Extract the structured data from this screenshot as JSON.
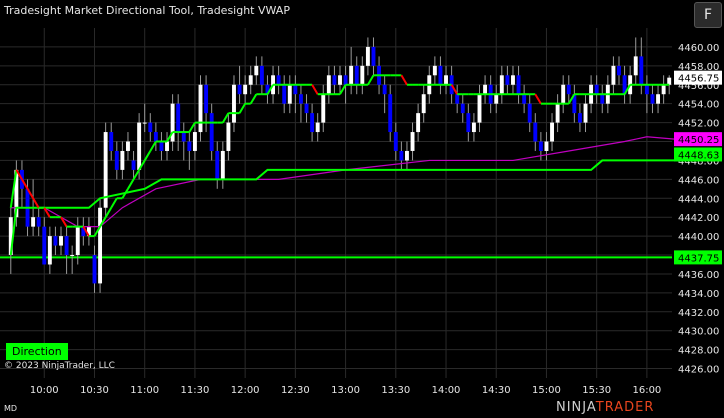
{
  "header": {
    "title": "Tradesight Market Directional Tool, Tradesight VWAP",
    "f_button": "F"
  },
  "overlay": {
    "direction_label": "Direction",
    "copyright": "© 2023 NinjaTrader, LLC",
    "md_label": "MD"
  },
  "brand": {
    "part1": "NINJA",
    "part2": "TRADER",
    "part2_color": "#e8451e"
  },
  "colors": {
    "background": "#000000",
    "grid": "#2a2a2a",
    "up_candle": "#ffffff",
    "down_candle": "#0000ff",
    "vwap_up": "#00ff00",
    "vwap_down": "#ff0000",
    "directional": "#00ff00",
    "magenta_line": "#c000c0",
    "current_price_box": "#ffffff",
    "magenta_box": "#ff00ff",
    "green_box": "#00ff00"
  },
  "chart_data": {
    "type": "candlestick",
    "title": "Tradesight Market Directional Tool, Tradesight VWAP",
    "ylim": [
      4425,
      4462
    ],
    "y_ticks": [
      "4460.00",
      "4458.00",
      "4456.00",
      "4454.00",
      "4452.00",
      "4450.00",
      "4448.00",
      "4446.00",
      "4444.00",
      "4442.00",
      "4440.00",
      "4438.00",
      "4436.00",
      "4434.00",
      "4432.00",
      "4430.00",
      "4428.00",
      "4426.00"
    ],
    "x_ticks": [
      "10:00",
      "10:30",
      "11:00",
      "11:30",
      "12:00",
      "12:30",
      "13:00",
      "13:30",
      "14:00",
      "14:30",
      "15:00",
      "15:30",
      "16:00"
    ],
    "x_tick_index": [
      6,
      15,
      24,
      33,
      42,
      51,
      60,
      69,
      78,
      87,
      96,
      105,
      114
    ],
    "candles": [
      [
        4438,
        4442,
        4436,
        4443
      ],
      [
        4442,
        4447,
        4441,
        4448
      ],
      [
        4447,
        4445,
        4443,
        4448
      ],
      [
        4445,
        4441,
        4440,
        4446
      ],
      [
        4441,
        4442,
        4440,
        4446
      ],
      [
        4442,
        4441,
        4440,
        4443
      ],
      [
        4441,
        4437,
        4437,
        4442
      ],
      [
        4437,
        4440,
        4436,
        4441
      ],
      [
        4440,
        4439,
        4438,
        4441
      ],
      [
        4439,
        4440,
        4438,
        4441
      ],
      [
        4440,
        4438,
        4436,
        4441
      ],
      [
        4438,
        4438,
        4436,
        4439
      ],
      [
        4438,
        4441,
        4437,
        4442
      ],
      [
        4441,
        4440,
        4439,
        4442
      ],
      [
        4440,
        4441,
        4439,
        4442
      ],
      [
        4438,
        4435,
        4434,
        4439
      ],
      [
        4435,
        4443,
        4434,
        4444
      ],
      [
        4443,
        4451,
        4442,
        4452
      ],
      [
        4451,
        4449,
        4448,
        4452
      ],
      [
        4449,
        4447,
        4446,
        4450
      ],
      [
        4447,
        4449,
        4446,
        4450
      ],
      [
        4449,
        4450,
        4448,
        4451
      ],
      [
        4448,
        4447,
        4446,
        4449
      ],
      [
        4447,
        4452,
        4446,
        4453
      ],
      [
        4452,
        4452,
        4451,
        4454
      ],
      [
        4452,
        4451,
        4450,
        4453
      ],
      [
        4451,
        4450,
        4449,
        4452
      ],
      [
        4450,
        4449,
        4448,
        4451
      ],
      [
        4449,
        4450,
        4448,
        4451
      ],
      [
        4450,
        4454,
        4449,
        4455
      ],
      [
        4454,
        4451,
        4449,
        4455
      ],
      [
        4451,
        4450,
        4448,
        4452
      ],
      [
        4450,
        4449,
        4447,
        4451
      ],
      [
        4449,
        4451,
        4448,
        4452
      ],
      [
        4451,
        4456,
        4450,
        4457
      ],
      [
        4456,
        4453,
        4451,
        4457
      ],
      [
        4453,
        4449,
        4448,
        4454
      ],
      [
        4449,
        4446,
        4445,
        4450
      ],
      [
        4446,
        4449,
        4445,
        4450
      ],
      [
        4449,
        4452,
        4448,
        4453
      ],
      [
        4452,
        4456,
        4451,
        4457
      ],
      [
        4456,
        4455,
        4454,
        4458
      ],
      [
        4455,
        4456,
        4454,
        4457
      ],
      [
        4456,
        4457,
        4455,
        4458
      ],
      [
        4457,
        4458,
        4456,
        4459
      ],
      [
        4458,
        4456,
        4455,
        4459
      ],
      [
        4456,
        4455,
        4454,
        4457
      ],
      [
        4455,
        4457,
        4454,
        4458
      ],
      [
        4457,
        4456,
        4455,
        4458
      ],
      [
        4456,
        4454,
        4453,
        4457
      ],
      [
        4454,
        4456,
        4453,
        4457
      ],
      [
        4456,
        4455,
        4453,
        4457
      ],
      [
        4455,
        4454,
        4452,
        4456
      ],
      [
        4454,
        4453,
        4452,
        4455
      ],
      [
        4453,
        4451,
        4450,
        4454
      ],
      [
        4451,
        4452,
        4450,
        4453
      ],
      [
        4452,
        4455,
        4451,
        4456
      ],
      [
        4455,
        4457,
        4454,
        4458
      ],
      [
        4457,
        4456,
        4455,
        4458
      ],
      [
        4456,
        4457,
        4455,
        4458
      ],
      [
        4457,
        4456,
        4454,
        4458
      ],
      [
        4456,
        4458,
        4455,
        4460
      ],
      [
        4458,
        4456,
        4455,
        4459
      ],
      [
        4456,
        4458,
        4455,
        4459
      ],
      [
        4458,
        4460,
        4457,
        4461
      ],
      [
        4460,
        4458,
        4457,
        4461
      ],
      [
        4458,
        4456,
        4455,
        4459
      ],
      [
        4456,
        4455,
        4453,
        4457
      ],
      [
        4455,
        4451,
        4450,
        4456
      ],
      [
        4451,
        4449,
        4448,
        4452
      ],
      [
        4449,
        4448,
        4447,
        4450
      ],
      [
        4448,
        4449,
        4447,
        4450
      ],
      [
        4449,
        4451,
        4448,
        4452
      ],
      [
        4451,
        4453,
        4450,
        4454
      ],
      [
        4453,
        4455,
        4452,
        4456
      ],
      [
        4455,
        4457,
        4454,
        4458
      ],
      [
        4457,
        4458,
        4456,
        4459
      ],
      [
        4458,
        4456,
        4455,
        4459
      ],
      [
        4456,
        4457,
        4455,
        4458
      ],
      [
        4457,
        4455,
        4454,
        4458
      ],
      [
        4455,
        4454,
        4453,
        4456
      ],
      [
        4454,
        4453,
        4452,
        4455
      ],
      [
        4453,
        4451,
        4450,
        4454
      ],
      [
        4451,
        4452,
        4450,
        4453
      ],
      [
        4452,
        4455,
        4451,
        4456
      ],
      [
        4455,
        4456,
        4454,
        4457
      ],
      [
        4456,
        4454,
        4453,
        4457
      ],
      [
        4454,
        4455,
        4453,
        4456
      ],
      [
        4455,
        4457,
        4454,
        4458
      ],
      [
        4457,
        4456,
        4455,
        4458
      ],
      [
        4456,
        4457,
        4455,
        4458
      ],
      [
        4457,
        4455,
        4454,
        4458
      ],
      [
        4455,
        4454,
        4453,
        4456
      ],
      [
        4454,
        4452,
        4451,
        4455
      ],
      [
        4452,
        4450,
        4449,
        4453
      ],
      [
        4450,
        4449,
        4448,
        4451
      ],
      [
        4449,
        4450,
        4448,
        4451
      ],
      [
        4450,
        4452,
        4449,
        4453
      ],
      [
        4452,
        4454,
        4451,
        4455
      ],
      [
        4454,
        4456,
        4453,
        4457
      ],
      [
        4456,
        4455,
        4454,
        4457
      ],
      [
        4455,
        4453,
        4452,
        4456
      ],
      [
        4453,
        4452,
        4451,
        4454
      ],
      [
        4452,
        4454,
        4451,
        4455
      ],
      [
        4454,
        4456,
        4453,
        4457
      ],
      [
        4456,
        4455,
        4454,
        4457
      ],
      [
        4455,
        4454,
        4453,
        4456
      ],
      [
        4454,
        4456,
        4453,
        4457
      ],
      [
        4456,
        4458,
        4455,
        4459
      ],
      [
        4458,
        4457,
        4456,
        4459
      ],
      [
        4457,
        4455,
        4454,
        4458
      ],
      [
        4455,
        4457,
        4454,
        4458
      ],
      [
        4457,
        4459,
        4456,
        4461
      ],
      [
        4459,
        4456,
        4455,
        4461
      ],
      [
        4456,
        4455,
        4453,
        4457
      ],
      [
        4455,
        4454,
        4453,
        4456
      ],
      [
        4454,
        4455,
        4453,
        4456
      ],
      [
        4455,
        4456,
        4454,
        4457
      ],
      [
        4456,
        4456.75,
        4455,
        4457
      ]
    ],
    "vwap": [
      4443,
      4447,
      4446,
      4445,
      4444,
      4443,
      4443,
      4442,
      4442,
      4442,
      4441,
      4441,
      4441,
      4441,
      4440,
      4440,
      4441,
      4442,
      4443,
      4444,
      4444,
      4445,
      4446,
      4447,
      4448,
      4449,
      4450,
      4450,
      4450,
      4451,
      4451,
      4451,
      4451,
      4452,
      4452,
      4452,
      4452,
      4452,
      4452,
      4453,
      4453,
      4453,
      4454,
      4454,
      4455,
      4455,
      4455,
      4456,
      4456,
      4456,
      4456,
      4456,
      4456,
      4456,
      4456,
      4455,
      4455,
      4455,
      4455,
      4455,
      4456,
      4456,
      4456,
      4456,
      4456,
      4457,
      4457,
      4457,
      4457,
      4457,
      4457,
      4456,
      4456,
      4456,
      4456,
      4456,
      4456,
      4456,
      4456,
      4456,
      4455,
      4455,
      4455,
      4455,
      4455,
      4455,
      4455,
      4455,
      4455,
      4455,
      4455,
      4455,
      4455,
      4455,
      4455,
      4454,
      4454,
      4454,
      4454,
      4454,
      4454,
      4455,
      4455,
      4455,
      4455,
      4455,
      4455,
      4455,
      4455,
      4455,
      4455,
      4456,
      4456,
      4456,
      4456,
      4456,
      4456,
      4456,
      4456
    ],
    "directional_steps": [
      [
        0,
        4438
      ],
      [
        1,
        4443
      ],
      [
        14,
        4443
      ],
      [
        16,
        4444
      ],
      [
        24,
        4445
      ],
      [
        27,
        4446
      ],
      [
        44,
        4446
      ],
      [
        46,
        4447
      ],
      [
        104,
        4447
      ],
      [
        106,
        4448
      ],
      [
        119,
        4448
      ]
    ],
    "magenta_line": [
      [
        0,
        4443
      ],
      [
        6,
        4443
      ],
      [
        12,
        4441
      ],
      [
        16,
        4441
      ],
      [
        20,
        4443
      ],
      [
        26,
        4445
      ],
      [
        34,
        4446
      ],
      [
        48,
        4446
      ],
      [
        60,
        4447
      ],
      [
        75,
        4448
      ],
      [
        90,
        4448
      ],
      [
        100,
        4449
      ],
      [
        110,
        4450
      ],
      [
        114,
        4450.5
      ],
      [
        119,
        4450.25
      ]
    ],
    "horizontal_line": 4437.75,
    "price_labels": [
      {
        "text": "4456.75",
        "value": 4456.75,
        "style": "current"
      },
      {
        "text": "4450.25",
        "value": 4450.25,
        "style": "magenta"
      },
      {
        "text": "4448.63",
        "value": 4448.63,
        "style": "green"
      },
      {
        "text": "4437.75",
        "value": 4437.75,
        "style": "green"
      }
    ]
  }
}
